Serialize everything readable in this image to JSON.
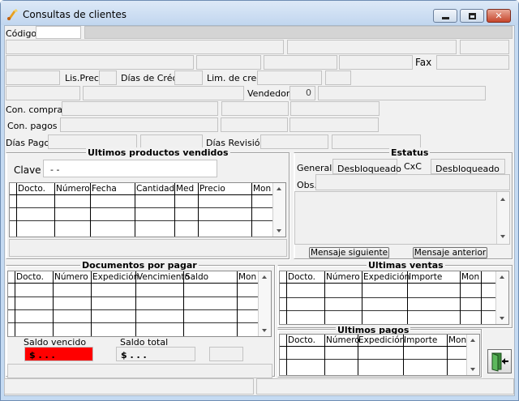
{
  "window": {
    "title": "Consultas de clientes",
    "minimize": "—",
    "maximize": "□",
    "close": "✕"
  },
  "header": {
    "codigo_label": "Código",
    "fax_label": "Fax",
    "lisprec_label": "Lis.Prec.",
    "dias_cred_label": "Días de Créd.",
    "lim_cred_label": "Lim. de cred.",
    "vendedor_label": "Vendedor",
    "vendedor_value": "0",
    "con_compras_label": "Con. compras",
    "con_pagos_label": "Con. pagos",
    "dias_pago_label": "Días Pago",
    "dias_revision_label": "Días Revisión"
  },
  "productos": {
    "title": "Ultimos productos vendidos",
    "clave_label": "Clave",
    "clave_value": "-  -",
    "columns": [
      "Docto.",
      "Número",
      "Fecha",
      "Cantidad",
      "Med",
      "Precio",
      "Mon"
    ]
  },
  "estatus": {
    "title": "Estatus",
    "general_label": "General",
    "general_value": "Desbloqueado",
    "cxc_label": "CxC",
    "cxc_value": "Desbloqueado",
    "obs_label": "Obs.",
    "next_button": "Mensaje siguiente",
    "prev_button": "Mensaje anterior"
  },
  "documentos": {
    "title": "Documentos por pagar",
    "columns": [
      "Docto.",
      "Número",
      "Expedición",
      "Vencimiento",
      "Saldo",
      "Mon"
    ],
    "saldo_vencido_label": "Saldo vencido",
    "saldo_vencido_value": "$   .   .   .",
    "saldo_total_label": "Saldo total",
    "saldo_total_value": "$   .   .   ."
  },
  "ultimas_ventas": {
    "title": "Ultimas ventas",
    "columns": [
      "Docto.",
      "Número",
      "Expedición",
      "Importe",
      "Mon"
    ]
  },
  "ultimos_pagos": {
    "title": "Ultimos pagos",
    "columns": [
      "Docto.",
      "Número",
      "Expedición",
      "Importe",
      "Mon"
    ]
  },
  "colors": {
    "alert": "#ff0000",
    "titlebar": "#c4daf2"
  }
}
